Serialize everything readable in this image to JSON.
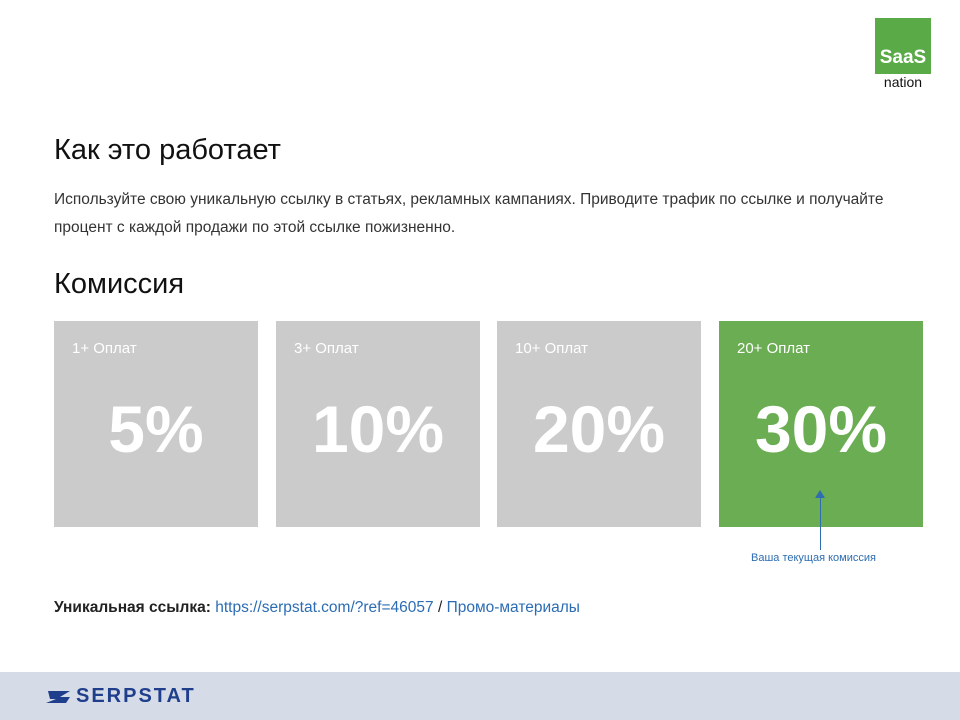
{
  "partner_logo": {
    "top": "SaaS",
    "bottom": "nation"
  },
  "how_it_works": {
    "title": "Как это работает",
    "description": "Используйте свою уникальную ссылку в статьях, рекламных кампаниях. Приводите трафик по ссылке и получайте процент с каждой продажи по этой ссылке пожизненно."
  },
  "commission": {
    "title": "Комиссия",
    "tiers": [
      {
        "label": "1+ Оплат",
        "value": "5%"
      },
      {
        "label": "3+ Оплат",
        "value": "10%"
      },
      {
        "label": "10+ Оплат",
        "value": "20%"
      },
      {
        "label": "20+ Оплат",
        "value": "30%"
      }
    ],
    "current_note": "Ваша текущая комиссия",
    "colors": {
      "inactive": "#cbcbcb",
      "active": "#6aad52"
    }
  },
  "unique_link": {
    "label": "Уникальная ссылка:",
    "url": "https://serpstat.com/?ref=46057",
    "separator": " / ",
    "promo": "Промо-материалы"
  },
  "footer": {
    "brand": "SERPSTAT",
    "icon": "serpstat-logo-icon"
  }
}
